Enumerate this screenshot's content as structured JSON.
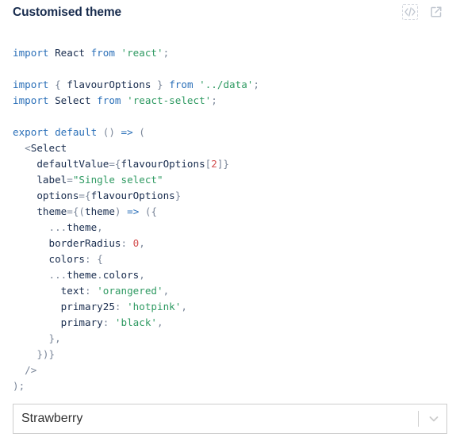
{
  "header": {
    "title": "Customised theme",
    "source_icon": "code-source-icon",
    "open_icon": "open-in-new-icon"
  },
  "code_lines": [
    [
      {
        "t": "import",
        "c": "kw"
      },
      {
        "t": " React ",
        "c": "id"
      },
      {
        "t": "from",
        "c": "kw"
      },
      {
        "t": " ",
        "c": "id"
      },
      {
        "t": "'react'",
        "c": "str"
      },
      {
        "t": ";",
        "c": "pn"
      }
    ],
    [],
    [
      {
        "t": "import",
        "c": "kw"
      },
      {
        "t": " ",
        "c": "id"
      },
      {
        "t": "{",
        "c": "pn"
      },
      {
        "t": " flavourOptions ",
        "c": "id"
      },
      {
        "t": "}",
        "c": "pn"
      },
      {
        "t": " ",
        "c": "id"
      },
      {
        "t": "from",
        "c": "kw"
      },
      {
        "t": " ",
        "c": "id"
      },
      {
        "t": "'../data'",
        "c": "str"
      },
      {
        "t": ";",
        "c": "pn"
      }
    ],
    [
      {
        "t": "import",
        "c": "kw"
      },
      {
        "t": " Select ",
        "c": "id"
      },
      {
        "t": "from",
        "c": "kw"
      },
      {
        "t": " ",
        "c": "id"
      },
      {
        "t": "'react-select'",
        "c": "str"
      },
      {
        "t": ";",
        "c": "pn"
      }
    ],
    [],
    [
      {
        "t": "export",
        "c": "kw"
      },
      {
        "t": " ",
        "c": "id"
      },
      {
        "t": "default",
        "c": "kw"
      },
      {
        "t": " ",
        "c": "id"
      },
      {
        "t": "()",
        "c": "pn"
      },
      {
        "t": " ",
        "c": "id"
      },
      {
        "t": "=>",
        "c": "kw"
      },
      {
        "t": " ",
        "c": "id"
      },
      {
        "t": "(",
        "c": "pn"
      }
    ],
    [
      {
        "t": "  ",
        "c": "id"
      },
      {
        "t": "<",
        "c": "pn"
      },
      {
        "t": "Select",
        "c": "id"
      }
    ],
    [
      {
        "t": "    defaultValue",
        "c": "id"
      },
      {
        "t": "={",
        "c": "pn"
      },
      {
        "t": "flavourOptions",
        "c": "id"
      },
      {
        "t": "[",
        "c": "pn"
      },
      {
        "t": "2",
        "c": "num"
      },
      {
        "t": "]}",
        "c": "pn"
      }
    ],
    [
      {
        "t": "    label",
        "c": "id"
      },
      {
        "t": "=",
        "c": "pn"
      },
      {
        "t": "\"Single select\"",
        "c": "str"
      }
    ],
    [
      {
        "t": "    options",
        "c": "id"
      },
      {
        "t": "={",
        "c": "pn"
      },
      {
        "t": "flavourOptions",
        "c": "id"
      },
      {
        "t": "}",
        "c": "pn"
      }
    ],
    [
      {
        "t": "    theme",
        "c": "id"
      },
      {
        "t": "={(",
        "c": "pn"
      },
      {
        "t": "theme",
        "c": "id"
      },
      {
        "t": ")",
        "c": "pn"
      },
      {
        "t": " ",
        "c": "id"
      },
      {
        "t": "=>",
        "c": "kw"
      },
      {
        "t": " ",
        "c": "id"
      },
      {
        "t": "({",
        "c": "pn"
      }
    ],
    [
      {
        "t": "      ",
        "c": "id"
      },
      {
        "t": "...",
        "c": "pn"
      },
      {
        "t": "theme",
        "c": "id"
      },
      {
        "t": ",",
        "c": "pn"
      }
    ],
    [
      {
        "t": "      borderRadius",
        "c": "id"
      },
      {
        "t": ":",
        "c": "pn"
      },
      {
        "t": " ",
        "c": "id"
      },
      {
        "t": "0",
        "c": "num"
      },
      {
        "t": ",",
        "c": "pn"
      }
    ],
    [
      {
        "t": "      colors",
        "c": "id"
      },
      {
        "t": ":",
        "c": "pn"
      },
      {
        "t": " ",
        "c": "id"
      },
      {
        "t": "{",
        "c": "pn"
      }
    ],
    [
      {
        "t": "      ",
        "c": "id"
      },
      {
        "t": "...",
        "c": "pn"
      },
      {
        "t": "theme",
        "c": "id"
      },
      {
        "t": ".",
        "c": "pn"
      },
      {
        "t": "colors",
        "c": "id"
      },
      {
        "t": ",",
        "c": "pn"
      }
    ],
    [
      {
        "t": "        text",
        "c": "id"
      },
      {
        "t": ":",
        "c": "pn"
      },
      {
        "t": " ",
        "c": "id"
      },
      {
        "t": "'orangered'",
        "c": "str"
      },
      {
        "t": ",",
        "c": "pn"
      }
    ],
    [
      {
        "t": "        primary25",
        "c": "id"
      },
      {
        "t": ":",
        "c": "pn"
      },
      {
        "t": " ",
        "c": "id"
      },
      {
        "t": "'hotpink'",
        "c": "str"
      },
      {
        "t": ",",
        "c": "pn"
      }
    ],
    [
      {
        "t": "        primary",
        "c": "id"
      },
      {
        "t": ":",
        "c": "pn"
      },
      {
        "t": " ",
        "c": "id"
      },
      {
        "t": "'black'",
        "c": "str"
      },
      {
        "t": ",",
        "c": "pn"
      }
    ],
    [
      {
        "t": "      ",
        "c": "id"
      },
      {
        "t": "},",
        "c": "pn"
      }
    ],
    [
      {
        "t": "    ",
        "c": "id"
      },
      {
        "t": "})}",
        "c": "pn"
      }
    ],
    [
      {
        "t": "  ",
        "c": "id"
      },
      {
        "t": "/>",
        "c": "pn"
      }
    ],
    [
      {
        "t": ");",
        "c": "pn"
      }
    ]
  ],
  "select": {
    "value": "Strawberry",
    "chevron_icon": "chevron-down-icon"
  },
  "colors": {
    "title": "#172b4d",
    "keyword": "#2a6fb8",
    "string": "#2f9a62",
    "punctuation": "#7a8699",
    "number": "#d34d4d",
    "border": "#cccccc",
    "icon_muted": "#c1c7d0"
  }
}
